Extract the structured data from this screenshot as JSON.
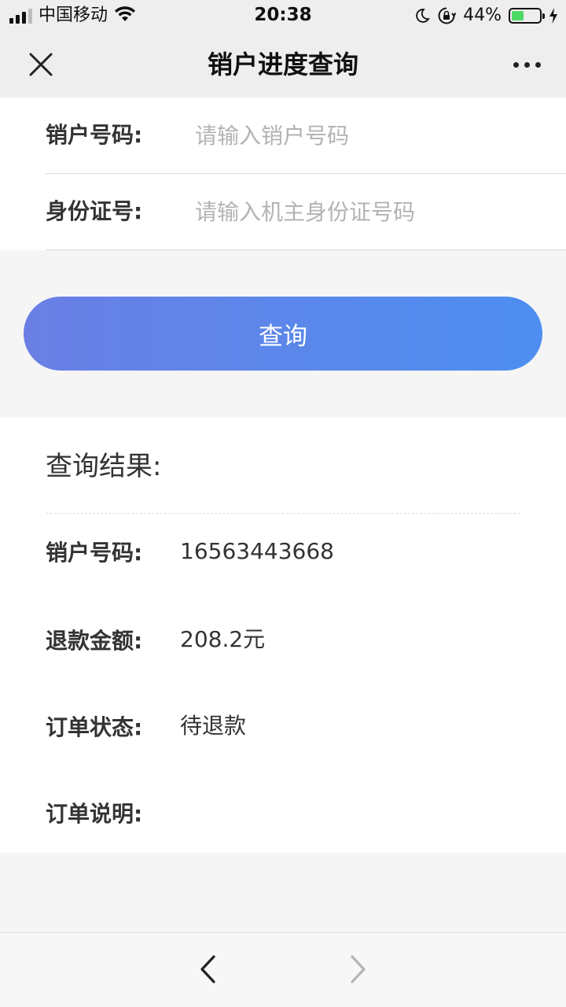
{
  "status_bar": {
    "carrier": "中国移动",
    "time": "20:38",
    "battery_percent": "44%",
    "battery_level": 0.44,
    "signal_bars_active": 3,
    "icons": [
      "signal-icon",
      "wifi-icon",
      "moon-icon",
      "rotation-lock-icon",
      "battery-icon",
      "charging-icon"
    ]
  },
  "nav": {
    "title": "销户进度查询",
    "close_icon": "close-icon",
    "more_icon": "more-icon"
  },
  "form": {
    "account": {
      "label": "销户号码:",
      "placeholder": "请输入销户号码",
      "value": ""
    },
    "id_card": {
      "label": "身份证号:",
      "placeholder": "请输入机主身份证号码",
      "value": ""
    }
  },
  "query_button": {
    "label": "查询",
    "gradient": [
      "#6a7fe4",
      "#4d8ef0"
    ]
  },
  "result": {
    "title": "查询结果:",
    "rows": [
      {
        "label": "销户号码:",
        "value": "16563443668"
      },
      {
        "label": "退款金额:",
        "value": "208.2元"
      },
      {
        "label": "订单状态:",
        "value": "待退款"
      },
      {
        "label": "订单说明:",
        "value": ""
      }
    ]
  },
  "bottom_bar": {
    "back_icon": "chevron-left-icon",
    "forward_icon": "chevron-right-icon",
    "forward_enabled": false
  }
}
